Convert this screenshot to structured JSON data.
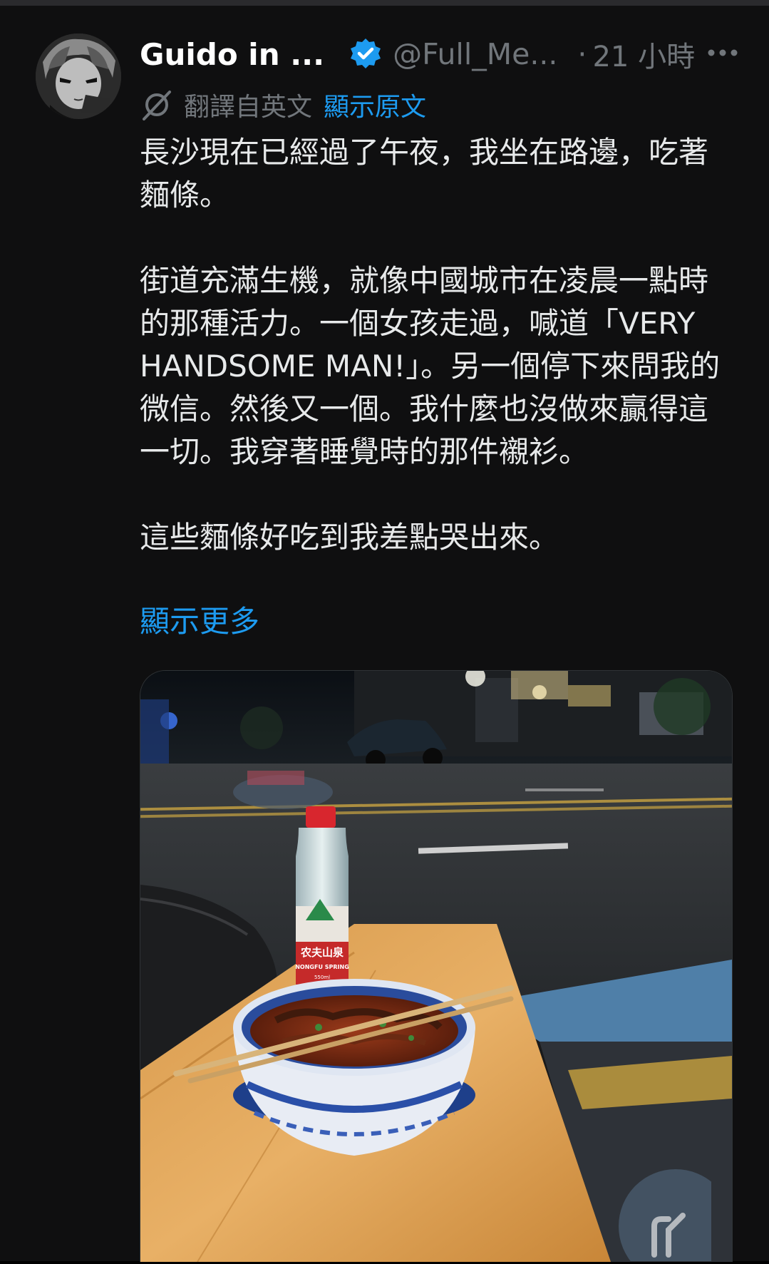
{
  "author": {
    "display_name": "Guido in ...",
    "handle": "@Full_Me...",
    "time_separator": "·",
    "time_ago": "21 小時",
    "verified_icon": "verified-badge-icon",
    "avatar_icon": "anime-avatar"
  },
  "translation": {
    "label": "翻譯自英文",
    "show_original": "顯示原文",
    "icon": "translate-icon"
  },
  "tweet": {
    "paragraphs": [
      "長沙現在已經過了午夜，我坐在路邊，吃著麵條。",
      "街道充滿生機，就像中國城市在凌晨一點時的那種活力。一個女孩走過，喊道「VERY HANDSOME MAN!」。另一個停下來問我的微信。然後又一個。我什麼也沒做來贏得這一切。我穿著睡覺時的那件襯衫。",
      "這些麵條好吃到我差點哭出來。"
    ],
    "show_more": "顯示更多"
  },
  "media": {
    "bottle_brand": "农夫山泉",
    "bottle_brand_en": "NONGFU SPRING",
    "bottle_volume": "550ml"
  },
  "colors": {
    "background": "#0f0f10",
    "text": "#e7e9ea",
    "muted": "#71767b",
    "link": "#1d9bf0",
    "verified": "#1d9bf0"
  }
}
